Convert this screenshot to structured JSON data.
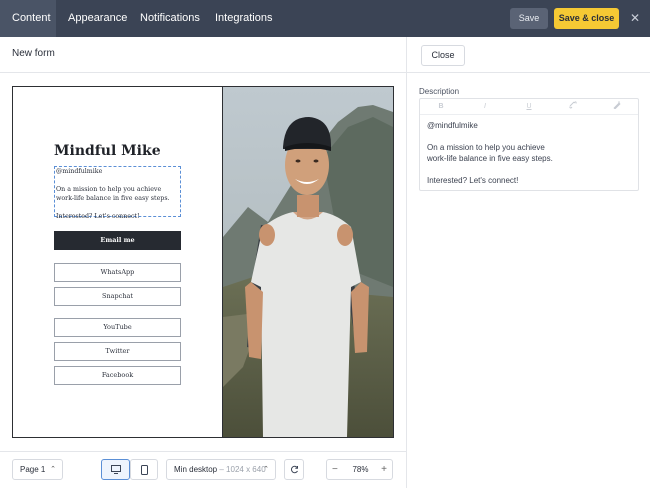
{
  "tabs": [
    {
      "label": "Content"
    },
    {
      "label": "Appearance"
    },
    {
      "label": "Notifications"
    },
    {
      "label": "Integrations"
    }
  ],
  "toolbar": {
    "save_label": "Save",
    "save_close_label": "Save & close",
    "close_symbol": "✕"
  },
  "form": {
    "name": "New form"
  },
  "panel": {
    "close_label": "Close",
    "description_label": "Description",
    "rich_text_buttons": [
      "B",
      "I",
      "U",
      "link-icon",
      "clear-format-icon"
    ],
    "description_lines": [
      "@mindfulmike",
      "",
      "On a mission to help you achieve",
      "work-life balance in five easy steps.",
      "",
      "Interested? Let's connect!"
    ]
  },
  "preview": {
    "profile_name": "Mindful Mike",
    "description_lines": [
      "@mindfulmike",
      "",
      "On a mission to help you achieve",
      "work-life balance in five easy steps.",
      "",
      "Interested? Let's connect!"
    ],
    "email_button": "Email me",
    "links": [
      "WhatsApp",
      "Snapchat",
      "YouTube",
      "Twitter",
      "Facebook"
    ]
  },
  "bottom": {
    "page_label": "Page 1",
    "size_label": "Min desktop",
    "size_value": "– 1024 x 640",
    "zoom_value": "78%",
    "zoom_minus": "−",
    "zoom_plus": "+"
  },
  "colors": {
    "topbar": "#3b4455",
    "accent_yellow": "#f5c934",
    "selection_blue": "#5b8fd6"
  }
}
